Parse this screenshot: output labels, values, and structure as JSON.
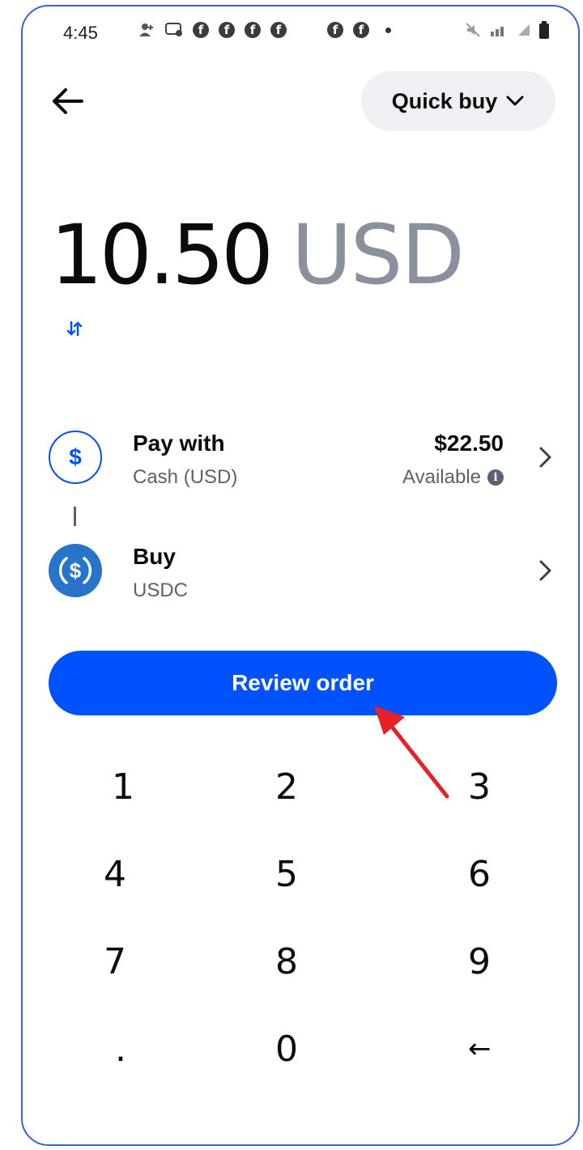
{
  "status_bar": {
    "time": "4:45"
  },
  "header": {
    "mode_label": "Quick buy"
  },
  "amount": {
    "value": "10.50",
    "currency": "USD"
  },
  "pay_with": {
    "title": "Pay with",
    "subtitle": "Cash (USD)",
    "balance": "$22.50",
    "balance_label": "Available"
  },
  "buy": {
    "title": "Buy",
    "subtitle": "USDC"
  },
  "review_button": {
    "label": "Review order"
  },
  "keypad": {
    "keys": [
      "1",
      "2",
      "3",
      "4",
      "5",
      "6",
      "7",
      "8",
      "9",
      ".",
      "0",
      "←"
    ]
  },
  "colors": {
    "accent": "#0052ff",
    "currency_gray": "#8a919e",
    "annotation_arrow": "#e82127",
    "frame_border": "#3a63d8"
  },
  "icons": [
    "back-arrow-icon",
    "chevron-down-icon",
    "swap-icon",
    "dollar-circle-icon",
    "usdc-icon",
    "chevron-right-icon",
    "info-icon"
  ]
}
